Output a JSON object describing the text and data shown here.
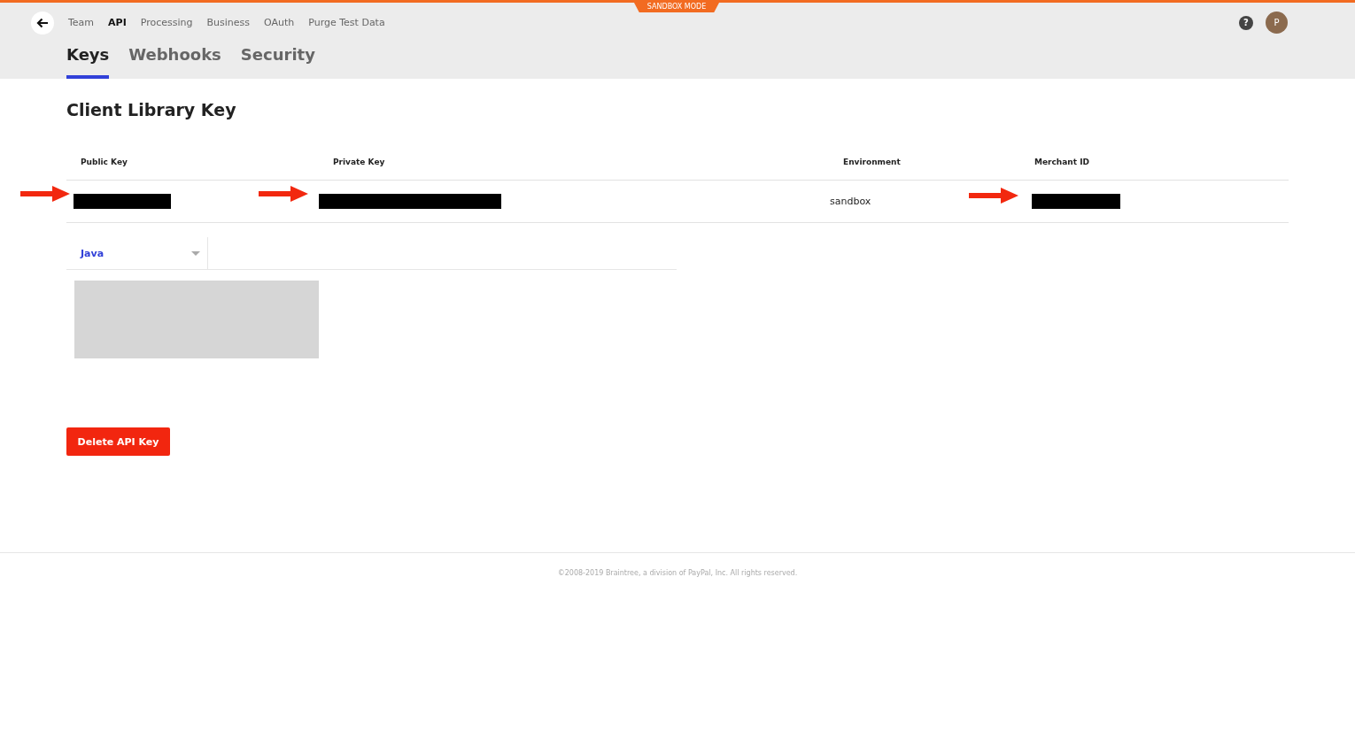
{
  "sandbox_badge": "SANDBOX MODE",
  "top_nav": [
    {
      "label": "Team",
      "selected": false
    },
    {
      "label": "API",
      "selected": true
    },
    {
      "label": "Processing",
      "selected": false
    },
    {
      "label": "Business",
      "selected": false
    },
    {
      "label": "OAuth",
      "selected": false
    },
    {
      "label": "Purge Test Data",
      "selected": false
    }
  ],
  "help": "?",
  "avatar": "P",
  "tabs": [
    {
      "label": "Keys",
      "selected": true
    },
    {
      "label": "Webhooks",
      "selected": false
    },
    {
      "label": "Security",
      "selected": false
    }
  ],
  "heading": "Client Library Key",
  "table": {
    "columns": [
      "Public Key",
      "Private Key",
      "Environment",
      "Merchant ID"
    ],
    "row": [
      {
        "kind": "redacted",
        "annotated": true
      },
      {
        "kind": "redacted",
        "annotated": true
      },
      {
        "kind": "text",
        "text": "sandbox",
        "annotated": false
      },
      {
        "kind": "redacted",
        "annotated": true
      }
    ]
  },
  "language_select": {
    "value": "Java"
  },
  "delete_button": "Delete API Key",
  "footer": "©2008-2019 Braintree, a division of PayPal, Inc. All rights reserved."
}
